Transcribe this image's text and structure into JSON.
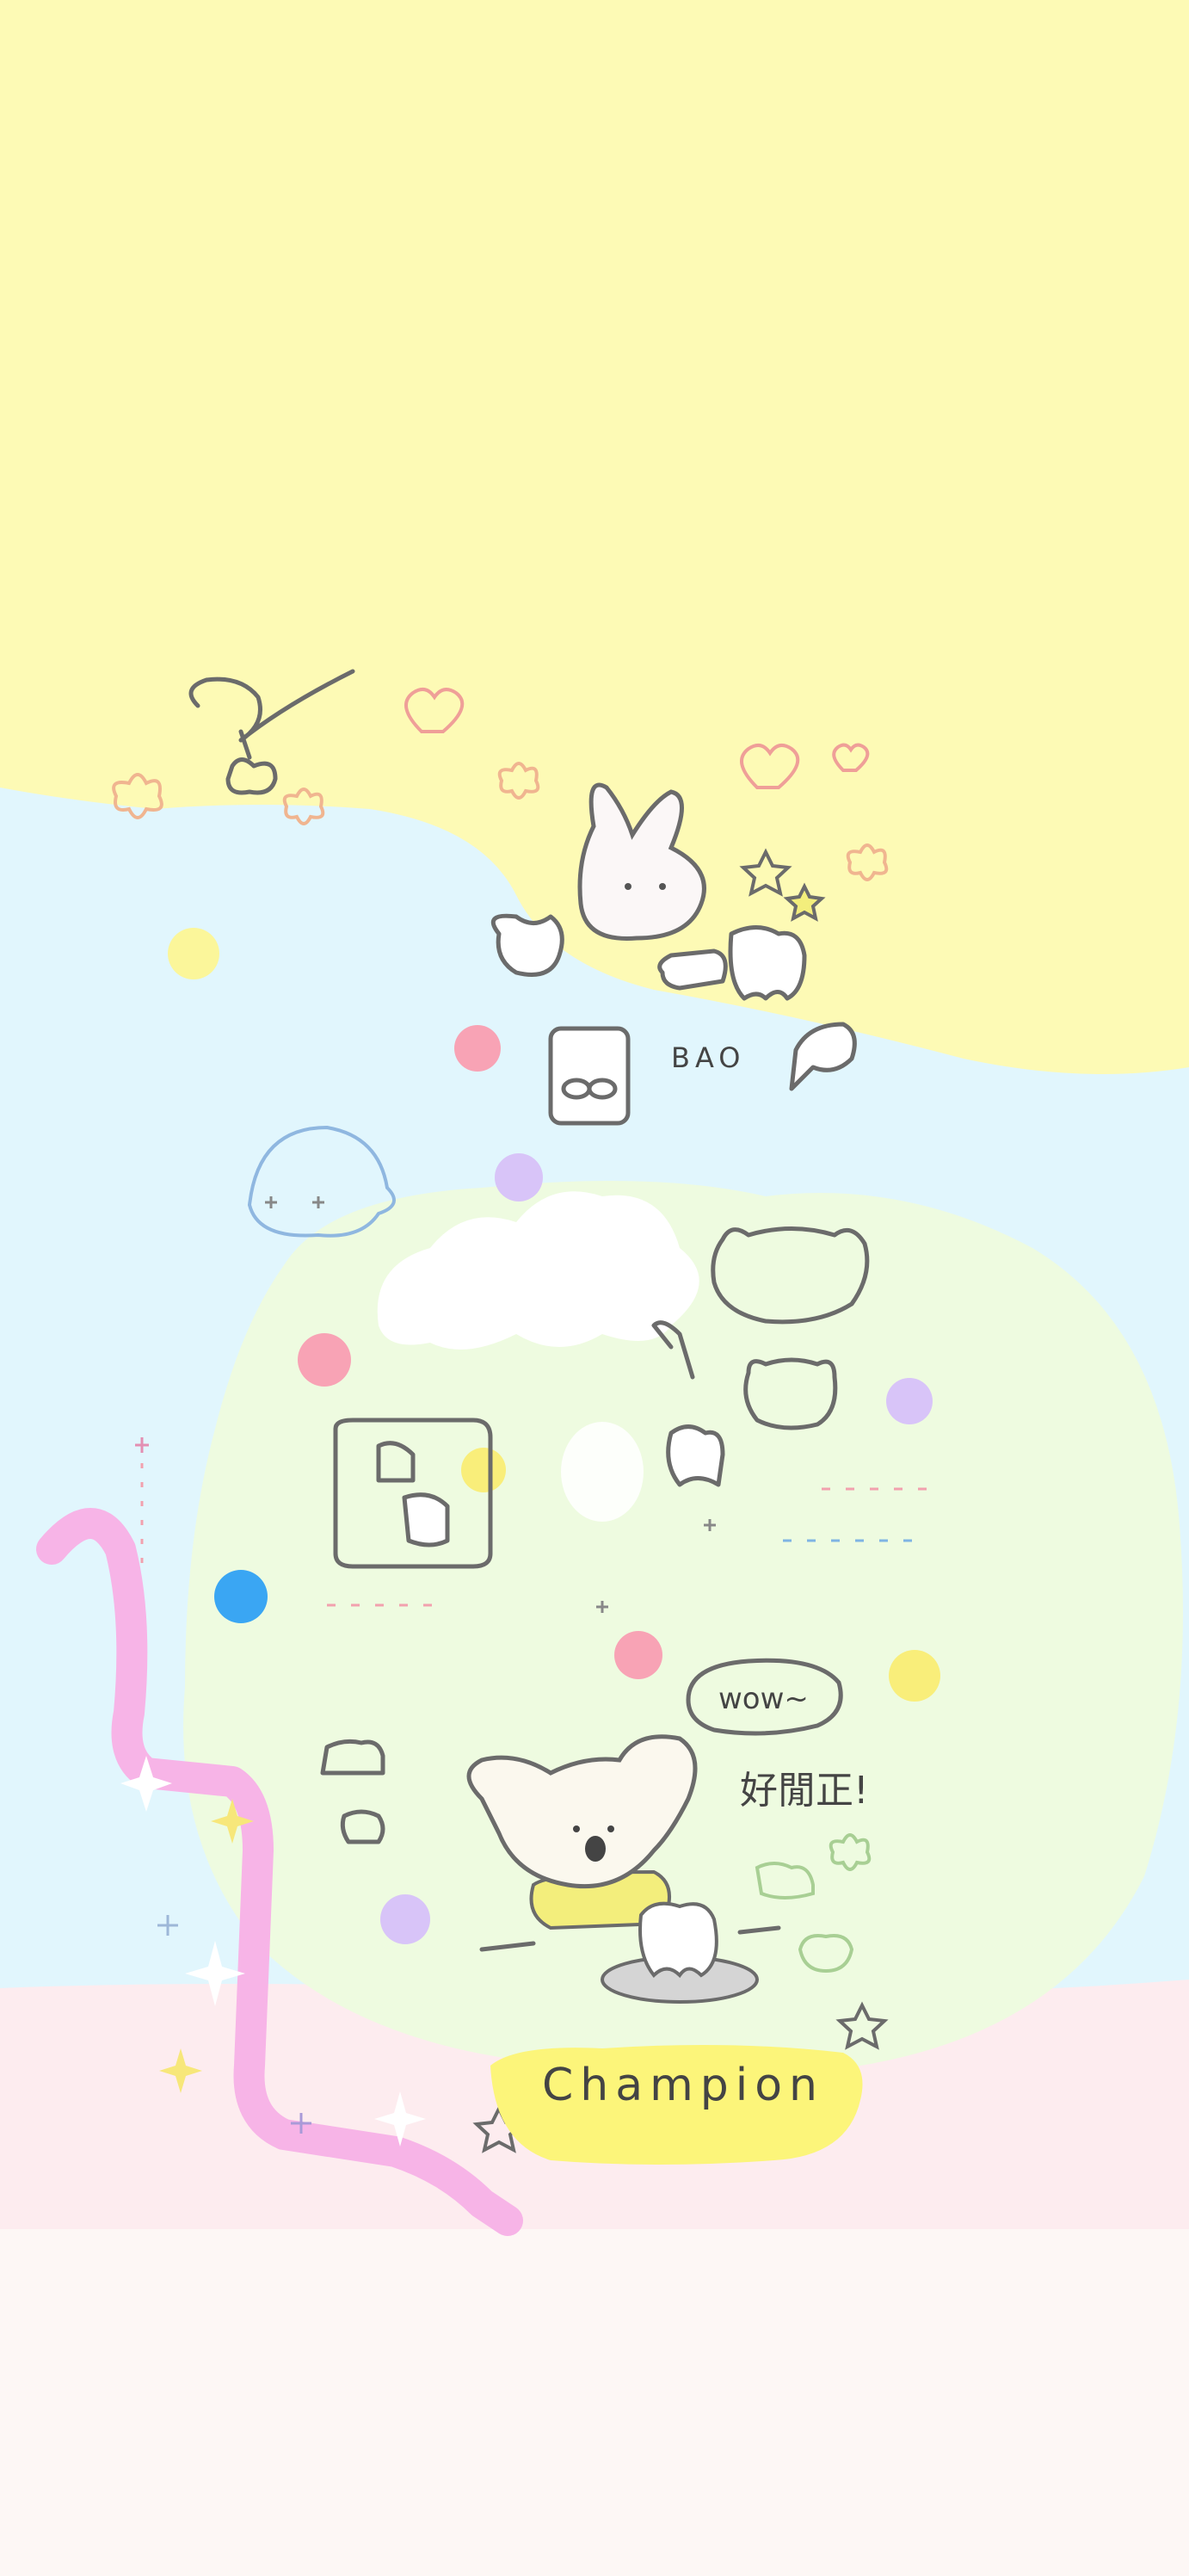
{
  "wallpaper": {
    "palette": {
      "yellow": "#fdfab5",
      "blue": "#e1f6fd",
      "green": "#effbe0",
      "pink_band": "#fde9ee",
      "bottom": "#fdf7f5",
      "ribbon": "#f7b4e7",
      "badge": "#fcf57a"
    },
    "texts": {
      "bao": "BAO",
      "wow": "wow~",
      "chinese_caption": "好閒正!",
      "badge": "Champion"
    },
    "dots": [
      {
        "color": "#fbf69a"
      },
      {
        "color": "#f8a3b5"
      },
      {
        "color": "#d8c4f8"
      },
      {
        "color": "#f8a3b5"
      },
      {
        "color": "#fbf69a"
      },
      {
        "color": "#d8c4f8"
      },
      {
        "color": "#3aa6f3"
      },
      {
        "color": "#f8a3b5"
      },
      {
        "color": "#f9ee7a"
      },
      {
        "color": "#d8c4f8"
      }
    ],
    "icons": [
      "cherry-icon",
      "heart-icon",
      "flower-icon",
      "bunny-icon",
      "tooth-icon",
      "speech-bubble-icon",
      "cloud-icon",
      "bear-icon",
      "koala-icon",
      "sparkle-icon",
      "star-icon"
    ]
  }
}
